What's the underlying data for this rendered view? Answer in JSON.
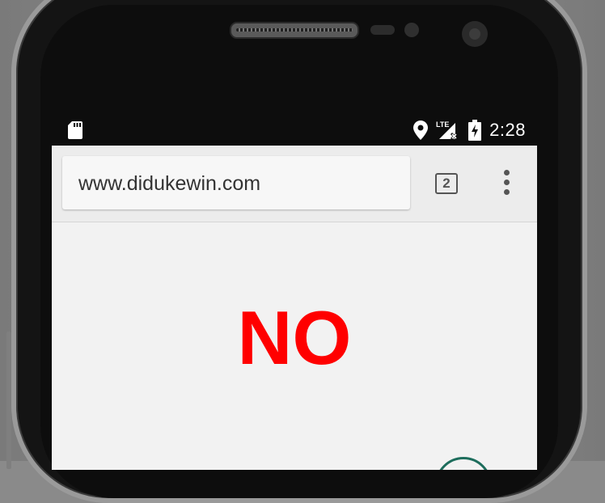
{
  "status_bar": {
    "time": "2:28",
    "network": "LTE",
    "icons": [
      "sd-card-icon",
      "location-icon",
      "signal-icon",
      "battery-charging-icon"
    ]
  },
  "browser": {
    "url": "www.didukewin.com",
    "tab_count": "2",
    "menu_icon": "more-vert-icon"
  },
  "page": {
    "answer": "NO",
    "answer_color": "#ff0000"
  }
}
